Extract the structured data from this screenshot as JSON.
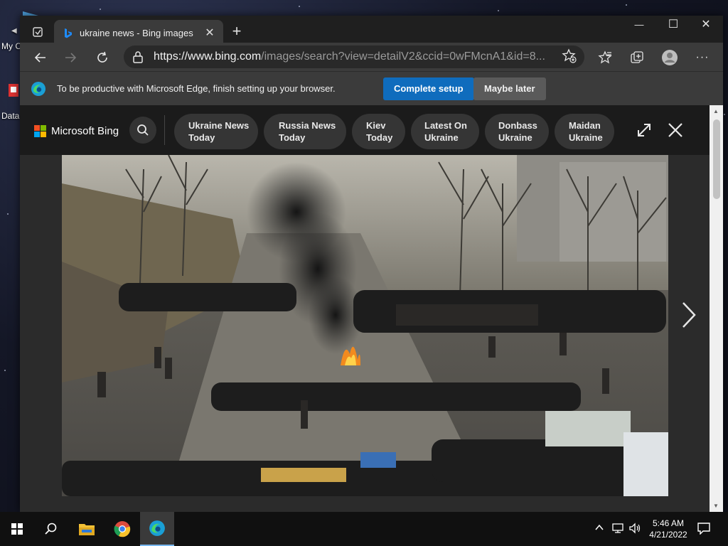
{
  "desktop": {
    "icons": [
      {
        "label": "My C"
      },
      {
        "label": "Data"
      }
    ]
  },
  "browser": {
    "tab": {
      "title": "ukraine news - Bing images",
      "favicon": "bing-icon"
    },
    "new_tab_symbol": "+",
    "window_controls": {
      "minimize": "—",
      "maximize": "☐",
      "close": "✕"
    },
    "address": {
      "host": "https://www.bing.com",
      "path": "/images/search?view=detailV2&ccid=0wFMcnA1&id=8..."
    },
    "infobar": {
      "message": "To be productive with Microsoft Edge, finish setting up your browser.",
      "complete_label": "Complete setup",
      "later_label": "Maybe later"
    }
  },
  "bing": {
    "logo_text": "Microsoft Bing",
    "related": [
      {
        "line1": "Ukraine News",
        "line2": "Today"
      },
      {
        "line1": "Russia News",
        "line2": "Today"
      },
      {
        "line1": "Kiev",
        "line2": "Today"
      },
      {
        "line1": "Latest On",
        "line2": "Ukraine"
      },
      {
        "line1": "Donbass",
        "line2": "Ukraine"
      },
      {
        "line1": "Maidan",
        "line2": "Ukraine"
      }
    ]
  },
  "taskbar": {
    "time": "5:46 AM",
    "date": "4/21/2022"
  },
  "colors": {
    "accent": "#0f6cbd",
    "maybe_later_bg": "#5a5a5a"
  }
}
